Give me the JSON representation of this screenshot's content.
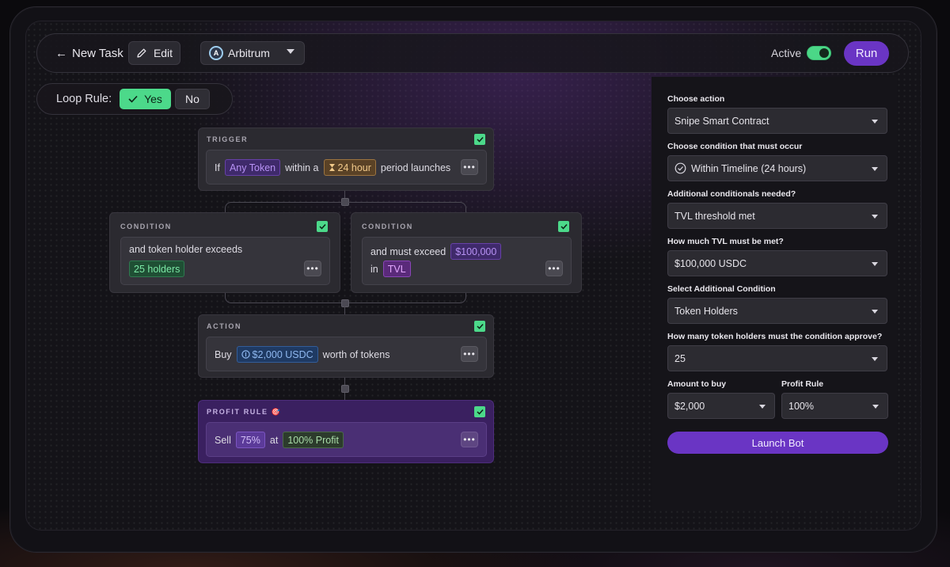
{
  "topbar": {
    "back_label": "New Task",
    "edit_label": "Edit",
    "chain": "Arbitrum",
    "active_label": "Active",
    "active": true,
    "run_label": "Run"
  },
  "loop_rule": {
    "label": "Loop Rule:",
    "yes_label": "Yes",
    "no_label": "No",
    "selected": "Yes"
  },
  "flow": {
    "trigger": {
      "title": "TRIGGER",
      "t1": "If",
      "token": "Any Token",
      "t2": "within a",
      "period": "24 hour",
      "t3": "period launches"
    },
    "condition_1": {
      "title": "CONDITION",
      "text": "and token holder exceeds",
      "value": "25 holders"
    },
    "condition_2": {
      "title": "CONDITION",
      "t1": "and must exceed",
      "amount": "$100,000",
      "t2": "in",
      "metric": "TVL"
    },
    "action": {
      "title": "ACTION",
      "t1": "Buy",
      "amount": "$2,000 USDC",
      "t2": "worth of tokens"
    },
    "profit_rule": {
      "title": "PROFIT RULE",
      "emoji": "🎯",
      "t1": "Sell",
      "percent": "75%",
      "t2": "at",
      "target": "100% Profit"
    }
  },
  "panel": {
    "action_label": "Choose action",
    "action_value": "Snipe Smart Contract",
    "condition_label": "Choose condition that must occur",
    "condition_value": "Within Timeline (24 hours)",
    "additional_label": "Additional conditionals needed?",
    "additional_value": "TVL threshold met",
    "tvl_label": "How much TVL must be met?",
    "tvl_value": "$100,000 USDC",
    "select_cond_label": "Select Additional Condition",
    "select_cond_value": "Token Holders",
    "holders_label": "How many token holders must the condition approve?",
    "holders_value": "25",
    "amount_label": "Amount to buy",
    "amount_value": "$2,000",
    "profit_label": "Profit Rule",
    "profit_value": "100%",
    "launch_label": "Launch Bot"
  },
  "colors": {
    "accent": "#6a35c4",
    "success": "#4cd98a",
    "background": "#0b0a0d"
  },
  "icons": [
    "back-arrow-icon",
    "pencil-icon",
    "arbitrum-logo-icon",
    "chevron-down-icon",
    "check-icon",
    "hourglass-icon",
    "more-icon",
    "usdc-icon",
    "clock-check-icon"
  ]
}
